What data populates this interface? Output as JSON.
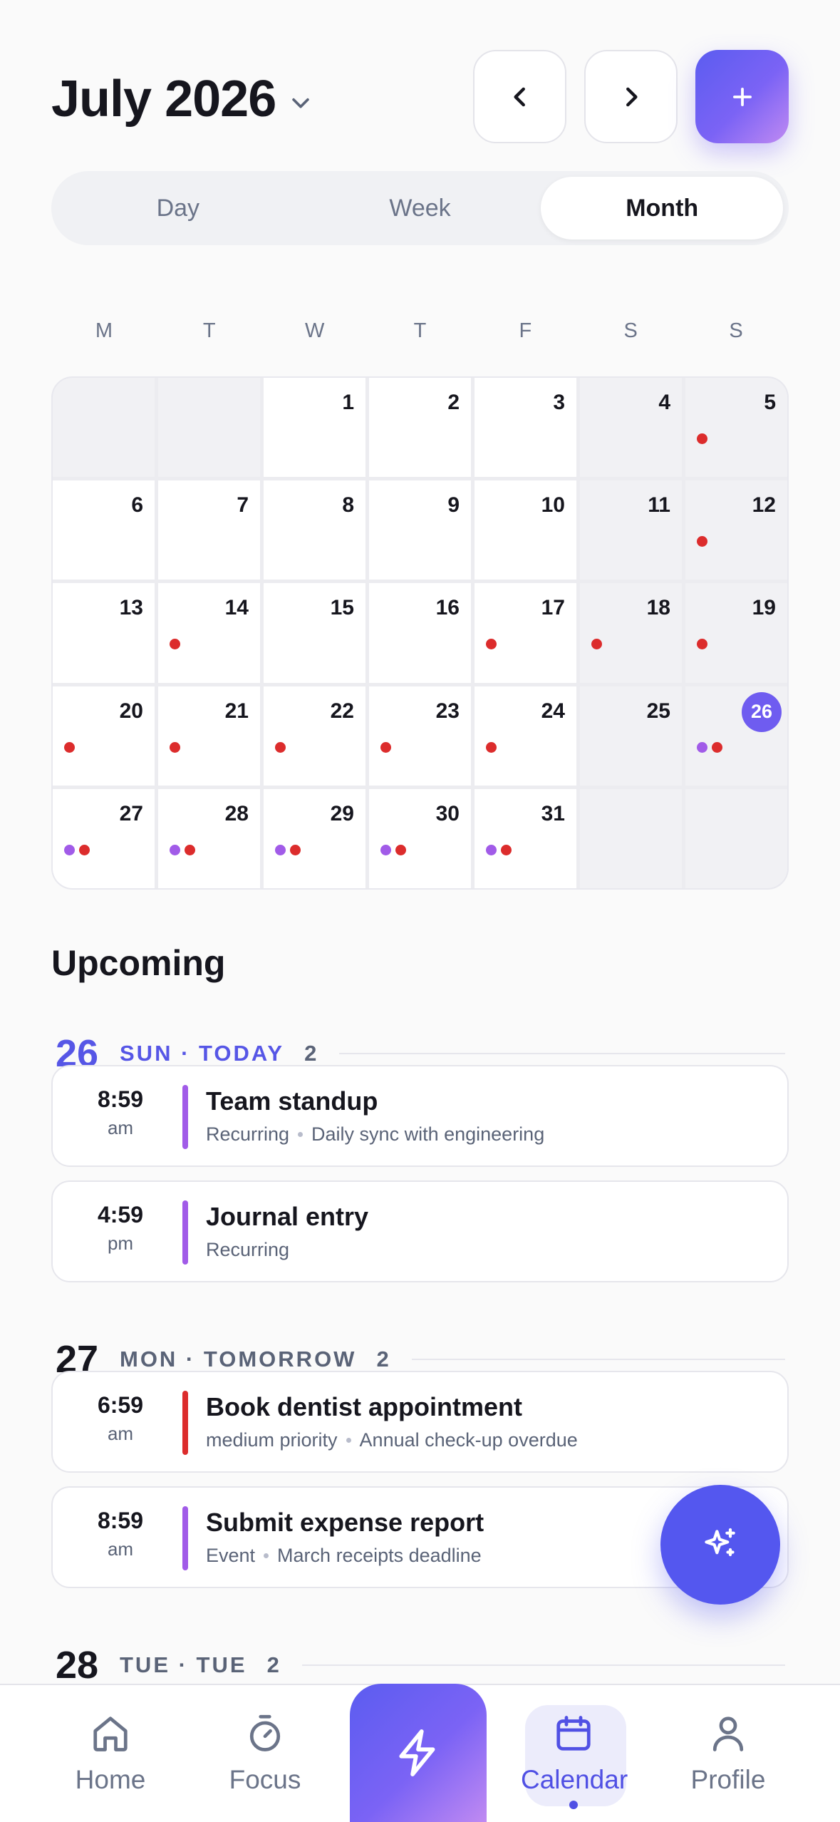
{
  "header": {
    "month_label": "July 2026",
    "icons": {
      "dropdown": "chevron-down-icon",
      "prev": "chevron-left-icon",
      "next": "chevron-right-icon",
      "add": "plus-icon"
    }
  },
  "view_tabs": [
    {
      "label": "Day",
      "active": false
    },
    {
      "label": "Week",
      "active": false
    },
    {
      "label": "Month",
      "active": true
    }
  ],
  "weekdays": [
    "M",
    "T",
    "W",
    "T",
    "F",
    "S",
    "S"
  ],
  "calendar": {
    "today": 26,
    "days": [
      {
        "n": "1",
        "dots": []
      },
      {
        "n": "2",
        "dots": []
      },
      {
        "n": "3",
        "dots": []
      },
      {
        "n": "4",
        "dots": []
      },
      {
        "n": "5",
        "dots": [
          "red"
        ]
      },
      {
        "n": "6",
        "dots": []
      },
      {
        "n": "7",
        "dots": []
      },
      {
        "n": "8",
        "dots": []
      },
      {
        "n": "9",
        "dots": []
      },
      {
        "n": "10",
        "dots": []
      },
      {
        "n": "11",
        "dots": []
      },
      {
        "n": "12",
        "dots": [
          "red"
        ]
      },
      {
        "n": "13",
        "dots": []
      },
      {
        "n": "14",
        "dots": [
          "red"
        ]
      },
      {
        "n": "15",
        "dots": []
      },
      {
        "n": "16",
        "dots": []
      },
      {
        "n": "17",
        "dots": [
          "red"
        ]
      },
      {
        "n": "18",
        "dots": [
          "red"
        ]
      },
      {
        "n": "19",
        "dots": [
          "red"
        ]
      },
      {
        "n": "20",
        "dots": [
          "red"
        ]
      },
      {
        "n": "21",
        "dots": [
          "red"
        ]
      },
      {
        "n": "22",
        "dots": [
          "red"
        ]
      },
      {
        "n": "23",
        "dots": [
          "red"
        ]
      },
      {
        "n": "24",
        "dots": [
          "red"
        ]
      },
      {
        "n": "25",
        "dots": []
      },
      {
        "n": "26",
        "dots": [
          "purple",
          "red"
        ]
      },
      {
        "n": "27",
        "dots": [
          "purple",
          "red"
        ]
      },
      {
        "n": "28",
        "dots": [
          "purple",
          "red"
        ]
      },
      {
        "n": "29",
        "dots": [
          "purple",
          "red"
        ]
      },
      {
        "n": "30",
        "dots": [
          "purple",
          "red"
        ]
      },
      {
        "n": "31",
        "dots": [
          "purple",
          "red"
        ]
      }
    ]
  },
  "upcoming": {
    "title": "Upcoming",
    "days": [
      {
        "num": "26",
        "label": "SUN · TODAY",
        "count": "2",
        "events": [
          {
            "time": "8:59",
            "ampm": "am",
            "title": "Team standup",
            "meta": [
              "Recurring",
              "Daily sync with engineering"
            ],
            "color": "purple"
          },
          {
            "time": "4:59",
            "ampm": "pm",
            "title": "Journal entry",
            "meta": [
              "Recurring"
            ],
            "color": "purple"
          }
        ]
      },
      {
        "num": "27",
        "label": "MON · TOMORROW",
        "count": "2",
        "events": [
          {
            "time": "6:59",
            "ampm": "am",
            "title": "Book dentist appointment",
            "meta": [
              "medium priority",
              "Annual check-up overdue"
            ],
            "color": "red"
          },
          {
            "time": "8:59",
            "ampm": "am",
            "title": "Submit expense report",
            "meta": [
              "Event",
              "March receipts deadline"
            ],
            "color": "purple"
          }
        ]
      },
      {
        "num": "28",
        "label": "TUE · TUE",
        "count": "2",
        "events": []
      }
    ]
  },
  "fab": {
    "icon": "sparkles-icon"
  },
  "bottom_nav": {
    "items": [
      {
        "label": "Home",
        "icon": "home-icon"
      },
      {
        "label": "Focus",
        "icon": "stopwatch-icon"
      },
      {
        "label": "",
        "icon": "lightning-icon"
      },
      {
        "label": "Calendar",
        "icon": "calendar-icon",
        "active": true
      },
      {
        "label": "Profile",
        "icon": "person-icon"
      }
    ]
  },
  "colors": {
    "accent": "#5457EF",
    "event_purple": "#A15BE8",
    "event_red": "#DC2C2C"
  }
}
